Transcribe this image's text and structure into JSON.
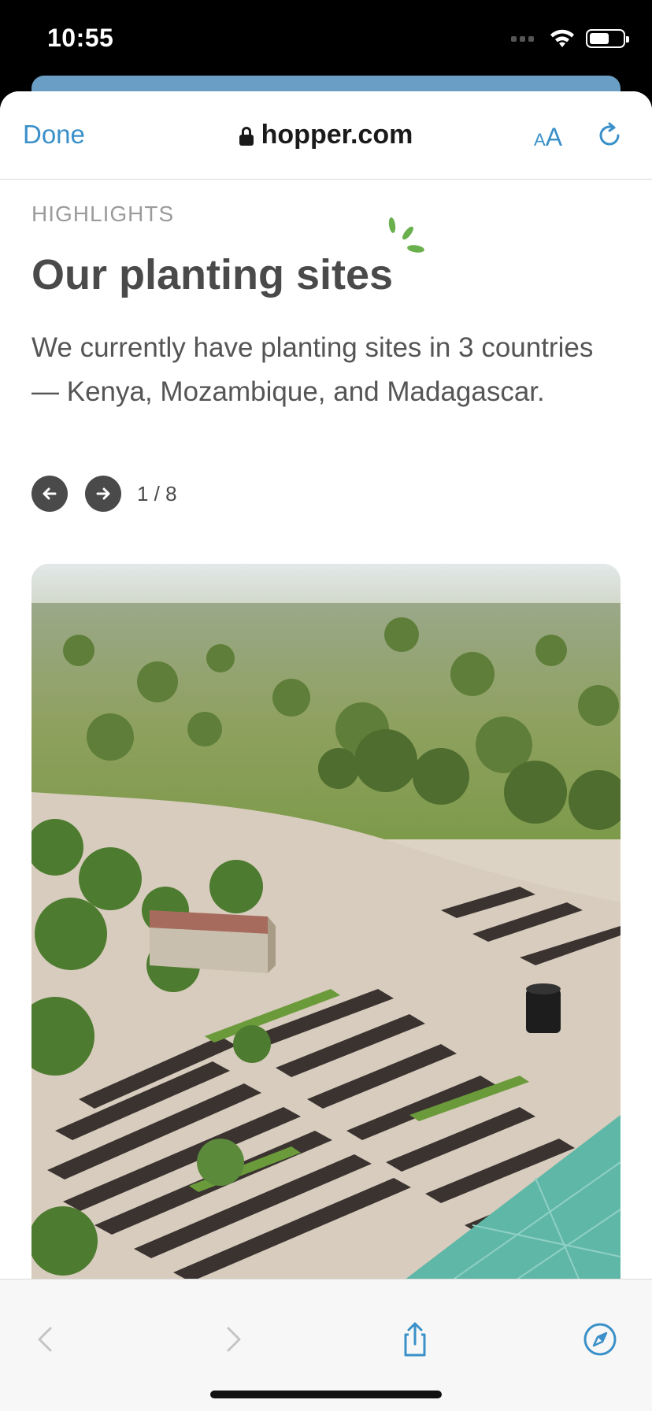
{
  "status_bar": {
    "time": "10:55"
  },
  "browser": {
    "done_label": "Done",
    "url": "hopper.com",
    "text_size_label_small": "A",
    "text_size_label_large": "A"
  },
  "section": {
    "eyebrow": "HIGHLIGHTS",
    "title": "Our planting sites",
    "description": "We currently have planting sites in 3 countries — Kenya, Mozambique, and Madagascar."
  },
  "carousel": {
    "counter": "1 / 8",
    "current": 1,
    "total": 8
  },
  "colors": {
    "link": "#3a90c8",
    "heading": "#4a4a4a",
    "sprout": "#6ab04c"
  }
}
